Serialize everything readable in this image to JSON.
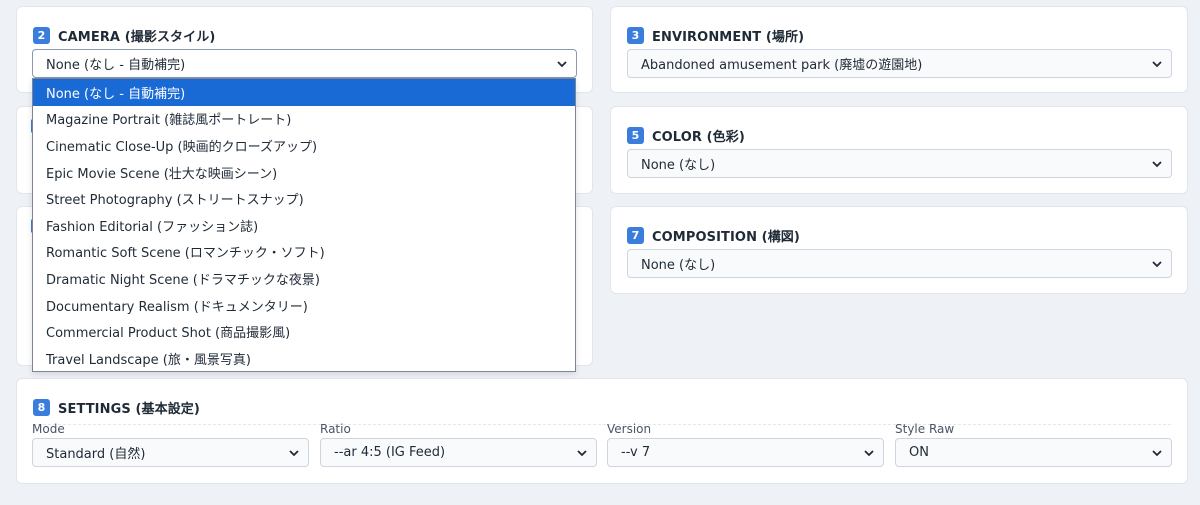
{
  "camera": {
    "number": "2",
    "title": "CAMERA (撮影スタイル)",
    "selected": "None (なし - 自動補完)",
    "options": [
      "None (なし - 自動補完)",
      "Magazine Portrait (雑誌風ポートレート)",
      "Cinematic Close-Up (映画的クローズアップ)",
      "Epic Movie Scene (壮大な映画シーン)",
      "Street Photography (ストリートスナップ)",
      "Fashion Editorial (ファッション誌)",
      "Romantic Soft Scene (ロマンチック・ソフト)",
      "Dramatic Night Scene (ドラマチックな夜景)",
      "Documentary Realism (ドキュメンタリー)",
      "Commercial Product Shot (商品撮影風)",
      "Travel Landscape (旅・風景写真)"
    ]
  },
  "environment": {
    "number": "3",
    "title": "ENVIRONMENT (場所)",
    "selected": "Abandoned amusement park (廃墟の遊園地)"
  },
  "color": {
    "number": "5",
    "title": "COLOR (色彩)",
    "selected": "None (なし)"
  },
  "composition": {
    "number": "7",
    "title": "COMPOSITION (構図)",
    "selected": "None (なし)"
  },
  "settings": {
    "number": "8",
    "title": "SETTINGS (基本設定)",
    "mode": {
      "label": "Mode",
      "selected": "Standard (自然)"
    },
    "ratio": {
      "label": "Ratio",
      "selected": "--ar 4:5 (IG Feed)"
    },
    "version": {
      "label": "Version",
      "selected": "--v 7"
    },
    "style_raw": {
      "label": "Style Raw",
      "selected": "ON"
    }
  },
  "colors": {
    "accent": "#3b7ddd",
    "selected_option": "#1a6ad6",
    "background": "#eef1f6"
  },
  "icons": {
    "select_arrow": "chevron-down-icon"
  }
}
